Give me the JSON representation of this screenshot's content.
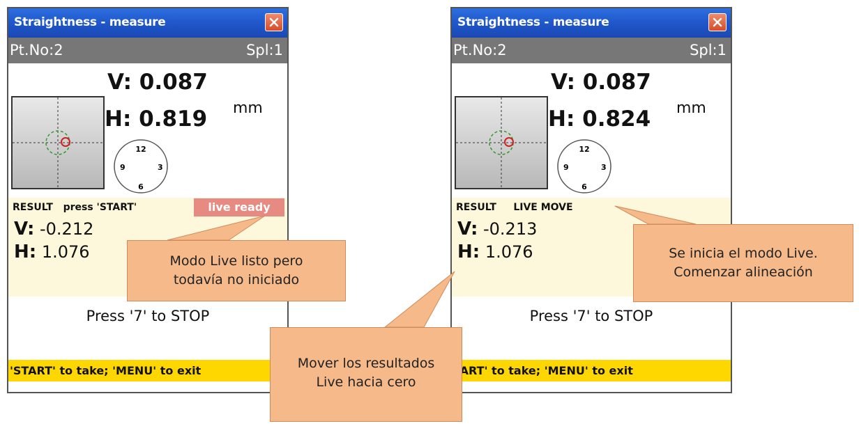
{
  "screens": [
    {
      "title": "Straightness - measure",
      "pt_no": "Pt.No:2",
      "spl": "Spl:1",
      "v_value": "V: 0.087",
      "h_value": "H: 0.819",
      "unit": "mm",
      "clock": {
        "top": "12",
        "left": "9",
        "right": "3",
        "bottom": "6"
      },
      "result_label": "RESULT   press 'START'",
      "badge": "live ready",
      "result_v_key": "V:",
      "result_v": "-0.212",
      "result_h_key": "H:",
      "result_h": "1.076",
      "stop_hint": "Press '7' to STOP",
      "footer": "'START' to take; 'MENU' to exit"
    },
    {
      "title": "Straightness - measure",
      "pt_no": "Pt.No:2",
      "spl": "Spl:1",
      "v_value": "V: 0.087",
      "h_value": "H: 0.824",
      "unit": "mm",
      "clock": {
        "top": "12",
        "left": "9",
        "right": "3",
        "bottom": "6"
      },
      "result_label": "RESULT     LIVE MOVE",
      "result_v_key": "V:",
      "result_v": "-0.213",
      "result_h_key": "H:",
      "result_h": "1.076",
      "stop_hint": "Press '7' to STOP",
      "footer": "TART' to take; 'MENU' to exit"
    }
  ],
  "callouts": {
    "live_ready": {
      "line1": "Modo Live listo pero",
      "line2": "todavía no iniciado"
    },
    "move_results": {
      "line1": "Mover los resultados",
      "line2": "Live hacia cero"
    },
    "live_started": {
      "line1": "Se inicia el modo Live.",
      "line2": "Comenzar alineación"
    }
  },
  "colors": {
    "titlebar": "#1f55c9",
    "infobar": "#777777",
    "badge": "#e78a82",
    "result_bg": "#fdf8dc",
    "footer": "#ffd700",
    "callout": "#f5b98a"
  }
}
